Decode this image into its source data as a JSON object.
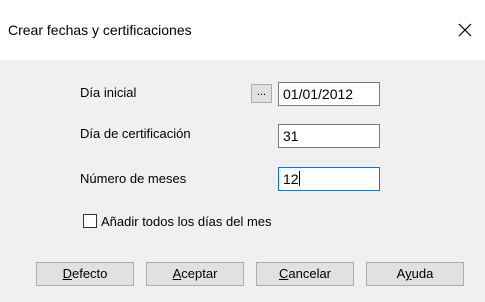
{
  "window": {
    "title": "Crear fechas y certificaciones",
    "close_glyph": "✕"
  },
  "form": {
    "start_day": {
      "label": "Día inicial",
      "browse_label": "...",
      "value": "01/01/2012"
    },
    "cert_day": {
      "label": "Día de certificación",
      "value": "31"
    },
    "months": {
      "label": "Número de meses",
      "value": "12"
    },
    "all_days": {
      "label": "Añadir todos los días del mes",
      "checked": false
    }
  },
  "buttons": {
    "defecto": {
      "mnemonic": "D",
      "rest": "efecto"
    },
    "aceptar": {
      "mnemonic": "A",
      "rest": "ceptar"
    },
    "cancelar": {
      "mnemonic": "C",
      "rest": "ancelar"
    },
    "ayuda": {
      "before": "A",
      "mnemonic": "y",
      "rest": "uda"
    }
  }
}
